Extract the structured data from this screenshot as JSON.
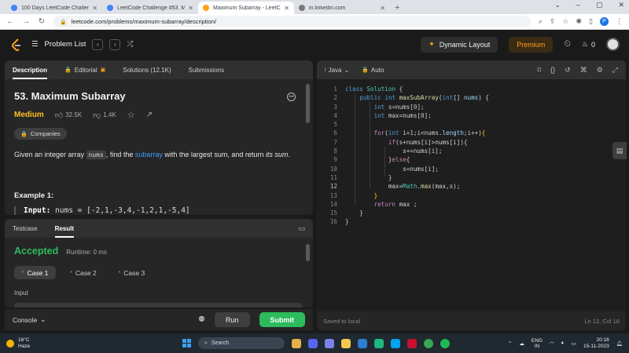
{
  "browser": {
    "tabs": [
      {
        "title": "100 Days LeetCode Challenge -",
        "color": "#4285f4",
        "active": false
      },
      {
        "title": "LeetCode Challenge #53. Maxim",
        "color": "#4285f4",
        "active": false
      },
      {
        "title": "Maximum Subarray - LeetCode",
        "color": "#ffa116",
        "active": true
      },
      {
        "title": "in.linkedin.com",
        "color": "#7a7a7a",
        "active": false
      }
    ],
    "url": "leetcode.com/problems/maximum-subarray/description/",
    "profile_initial": "P"
  },
  "nav": {
    "problem_list": "Problem List",
    "dynamic_layout": "Dynamic Layout",
    "premium": "Premium",
    "streak": "0"
  },
  "description_tabs": [
    "Description",
    "Editorial",
    "Solutions (12.1K)",
    "Submissions"
  ],
  "problem": {
    "title": "53. Maximum Subarray",
    "difficulty": "Medium",
    "likes": "32.5K",
    "dislikes": "1.4K",
    "companies": "Companies",
    "statement_pre": "Given an integer array ",
    "statement_code": "nums",
    "statement_mid": ", find the ",
    "statement_link": "subarray",
    "statement_post": " with the largest sum, and return ",
    "statement_em": "its sum",
    "statement_end": ".",
    "example_title": "Example 1:",
    "example_input_label": "Input:",
    "example_input_value": " nums = [-2,1,-3,4,-1,2,1,-5,4]"
  },
  "result": {
    "tabs": [
      "Testcase",
      "Result"
    ],
    "status": "Accepted",
    "runtime": "Runtime: 0 ms",
    "cases": [
      "Case 1",
      "Case 2",
      "Case 3"
    ],
    "input_label": "Input"
  },
  "bottom": {
    "console": "Console",
    "run": "Run",
    "submit": "Submit"
  },
  "editor": {
    "language": "Java",
    "mode": "Auto",
    "saved": "Saved to local",
    "position": "Ln 12, Col 16",
    "current_line": 12
  },
  "taskbar": {
    "temp": "16°C",
    "condition": "Haze",
    "search": "Search",
    "lang1": "ENG",
    "lang2": "IN",
    "time": "20:16",
    "date": "15-11-2023"
  }
}
